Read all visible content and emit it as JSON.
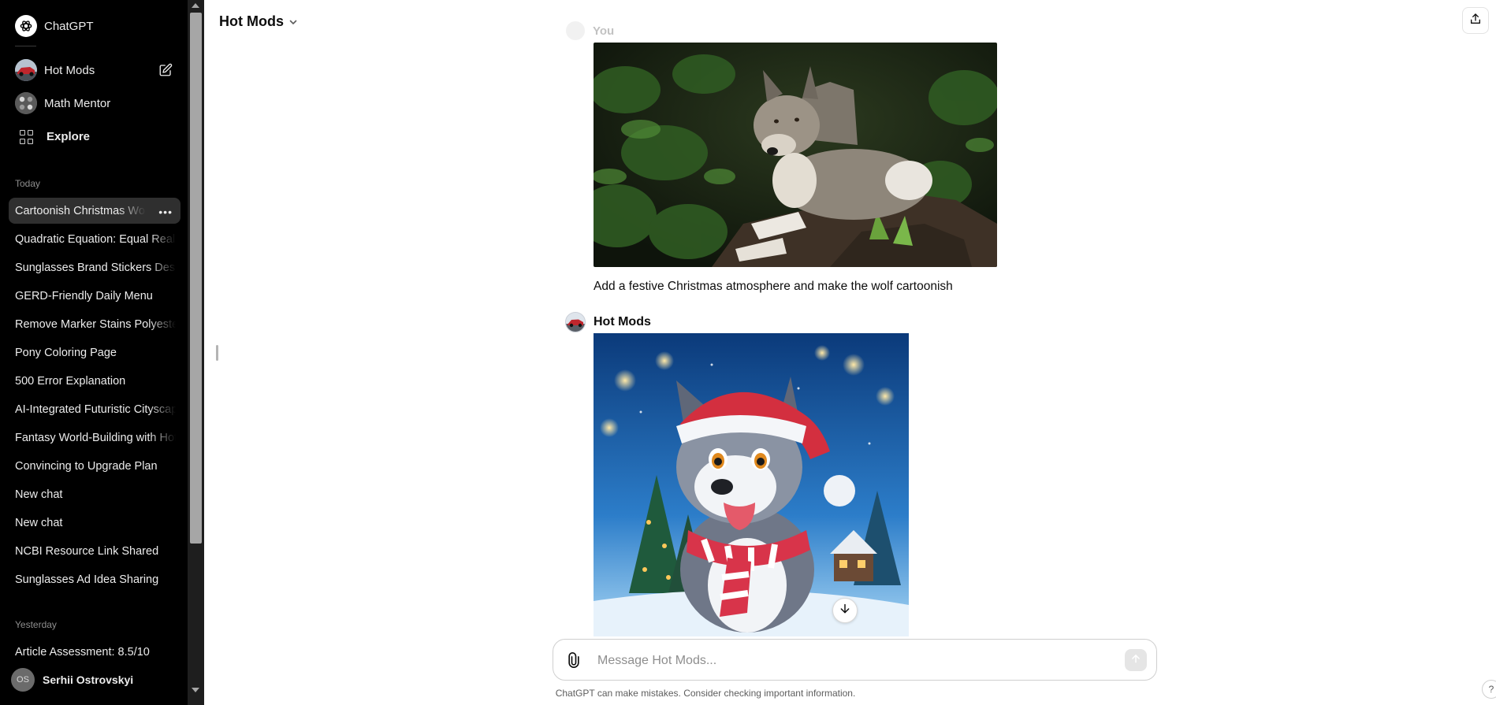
{
  "sidebar": {
    "brand": "ChatGPT",
    "gpts": [
      {
        "label": "Hot Mods"
      },
      {
        "label": "Math Mentor"
      }
    ],
    "explore_label": "Explore",
    "sections": [
      {
        "label": "Today",
        "items": [
          {
            "label": "Cartoonish Christmas Wolf Image"
          },
          {
            "label": "Quadratic Equation: Equal Real Roots"
          },
          {
            "label": "Sunglasses Brand Stickers Design"
          },
          {
            "label": "GERD-Friendly Daily Menu"
          },
          {
            "label": "Remove Marker Stains Polyester"
          },
          {
            "label": "Pony Coloring Page"
          },
          {
            "label": "500 Error Explanation"
          },
          {
            "label": "AI-Integrated Futuristic Cityscape"
          },
          {
            "label": "Fantasy World-Building with Hot Mods"
          },
          {
            "label": "Convincing to Upgrade Plan"
          },
          {
            "label": "New chat"
          },
          {
            "label": "New chat"
          },
          {
            "label": "NCBI Resource Link Shared"
          },
          {
            "label": "Sunglasses Ad Idea Sharing"
          }
        ]
      },
      {
        "label": "Yesterday",
        "items": [
          {
            "label": "Article Assessment: 8.5/10"
          }
        ]
      }
    ],
    "user": {
      "initials": "OS",
      "name": "Serhii Ostrovskyi"
    }
  },
  "header": {
    "title": "Hot Mods"
  },
  "conversation": {
    "user_label": "You",
    "user_message": "Add a festive Christmas atmosphere and make the wolf cartoonish",
    "assistant_label": "Hot Mods"
  },
  "composer": {
    "placeholder": "Message Hot Mods..."
  },
  "footer": {
    "disclaimer": "ChatGPT can make mistakes. Consider checking important information.",
    "help": "?"
  },
  "colors": {
    "sidebar_bg": "#000000",
    "active_item": "#2f2f2f",
    "main_bg": "#ffffff"
  }
}
